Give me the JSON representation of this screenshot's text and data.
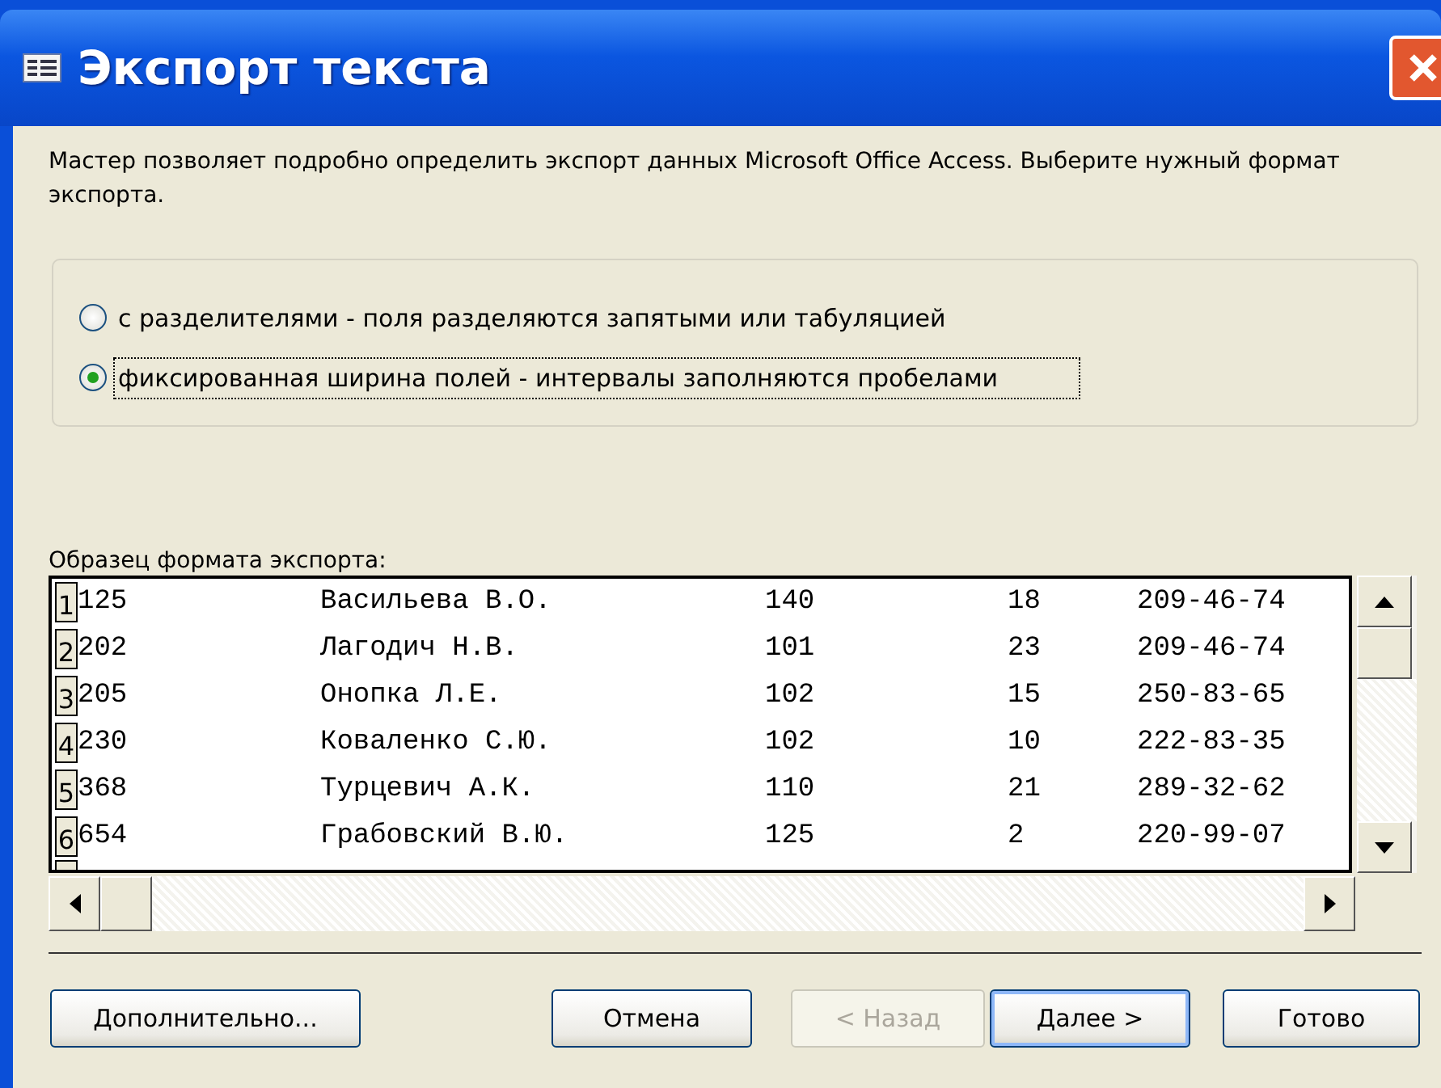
{
  "window": {
    "title": "Экспорт текста"
  },
  "description": "Мастер позволяет подробно определить экспорт данных Microsoft Office Access. Выберите нужный формат экспорта.",
  "format_options": [
    {
      "label": "с разделителями - поля разделяются запятыми или табуляцией",
      "selected": false
    },
    {
      "label": "фиксированная ширина полей - интервалы заполняются пробелами",
      "selected": true
    }
  ],
  "sample": {
    "label": "Образец формата экспорта:",
    "rows": [
      {
        "number": "1",
        "cells": [
          "125",
          "Васильева В.О.",
          "140",
          "18",
          "209-46-74"
        ]
      },
      {
        "number": "2",
        "cells": [
          "202",
          "Лагодич Н.В.",
          "101",
          "23",
          "209-46-74"
        ]
      },
      {
        "number": "3",
        "cells": [
          "205",
          "Онопка Л.Е.",
          "102",
          "15",
          "250-83-65"
        ]
      },
      {
        "number": "4",
        "cells": [
          "230",
          "Коваленко С.Ю.",
          "102",
          "10",
          "222-83-35"
        ]
      },
      {
        "number": "5",
        "cells": [
          "368",
          "Турцевич А.К.",
          "110",
          "21",
          "289-32-62"
        ]
      },
      {
        "number": "6",
        "cells": [
          "654",
          "Грабовский В.Ю.",
          "125",
          "2",
          "220-99-07"
        ]
      }
    ]
  },
  "buttons": [
    {
      "label": "Дополнительно...",
      "disabled": false,
      "default": false
    },
    {
      "label": "Отмена",
      "disabled": false,
      "default": false
    },
    {
      "label": "< Назад",
      "disabled": true,
      "default": false
    },
    {
      "label": "Далее >",
      "disabled": false,
      "default": true
    },
    {
      "label": "Готово",
      "disabled": false,
      "default": false
    }
  ]
}
